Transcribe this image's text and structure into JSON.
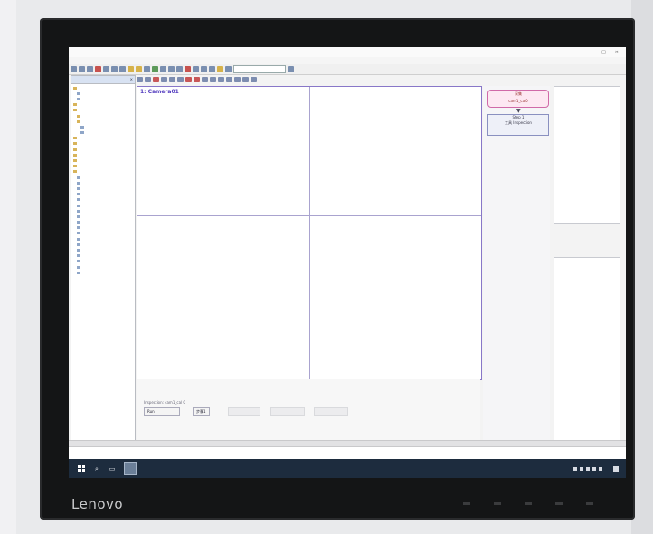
{
  "brand": "Lenovo",
  "canvas": {
    "label": "1: Camera01"
  },
  "flow": {
    "node1_title": "采集",
    "node1_sub": "cam1_cal0",
    "node2_title": "Step 1",
    "node2_sub": "工具 Inspection"
  },
  "bottom_panel": {
    "label": "Inspection: cam1_cal 0",
    "run_button": "Run",
    "next_button": "步骤1"
  },
  "colors": {
    "canvas_border": "#8877c8",
    "node_border": "#d06aa8",
    "taskbar": "#1d2c3e"
  },
  "icons": [
    "windows-start-icon",
    "search-icon",
    "task-view-icon",
    "app-icon",
    "tray-icons"
  ]
}
